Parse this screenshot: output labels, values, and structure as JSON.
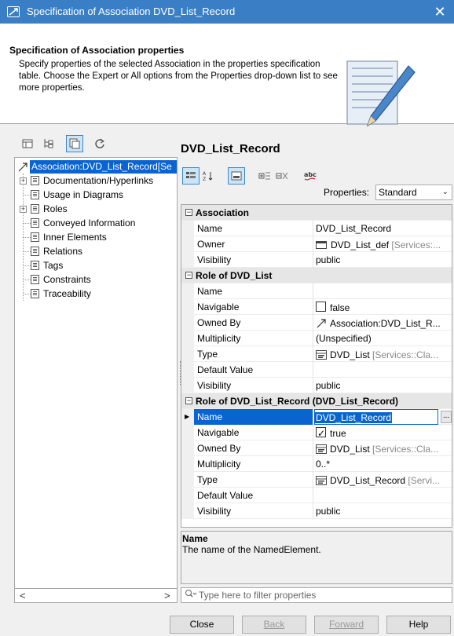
{
  "window": {
    "title": "Specification of Association DVD_List_Record",
    "close_glyph": "✕"
  },
  "header": {
    "title": "Specification of Association properties",
    "description": "Specify properties of the selected Association in the properties specification table. Choose the Expert or All options from the Properties drop-down list to see more properties."
  },
  "left_toolbar": {
    "icons": [
      "class-diagram-icon",
      "tree-icon",
      "copy-icon",
      "refresh-icon"
    ]
  },
  "tree": {
    "root": "Association:DVD_List_Record[Se",
    "items": [
      {
        "label": "Documentation/Hyperlinks",
        "expandable": true
      },
      {
        "label": "Usage in Diagrams",
        "expandable": false
      },
      {
        "label": "Roles",
        "expandable": true
      },
      {
        "label": "Conveyed Information",
        "expandable": false
      },
      {
        "label": "Inner Elements",
        "expandable": false
      },
      {
        "label": "Relations",
        "expandable": false
      },
      {
        "label": "Tags",
        "expandable": false
      },
      {
        "label": "Constraints",
        "expandable": false
      },
      {
        "label": "Traceability",
        "expandable": false
      }
    ]
  },
  "right": {
    "title": "DVD_List_Record",
    "properties_label": "Properties:",
    "properties_value": "Standard"
  },
  "grid": {
    "sections": [
      {
        "title": "Association",
        "rows": [
          {
            "name": "Name",
            "value": "DVD_List_Record"
          },
          {
            "name": "Owner",
            "value": "DVD_List_def",
            "suffix": " [Services:..."
          },
          {
            "name": "Visibility",
            "value": "public"
          }
        ]
      },
      {
        "title": "Role of DVD_List",
        "rows": [
          {
            "name": "Name",
            "value": ""
          },
          {
            "name": "Navigable",
            "value": "false"
          },
          {
            "name": "Owned By",
            "value": "Association:DVD_List_R..."
          },
          {
            "name": "Multiplicity",
            "value": "(Unspecified)"
          },
          {
            "name": "Type",
            "value": "DVD_List",
            "suffix": " [Services::Cla..."
          },
          {
            "name": "Default Value",
            "value": ""
          },
          {
            "name": "Visibility",
            "value": "public"
          }
        ]
      },
      {
        "title": "Role of DVD_List_Record (DVD_List_Record)",
        "rows": [
          {
            "name": "Name",
            "value": "DVD_List_Record",
            "ellipsis": "..."
          },
          {
            "name": "Navigable",
            "value": "true"
          },
          {
            "name": "Owned By",
            "value": "DVD_List",
            "suffix": " [Services::Cla..."
          },
          {
            "name": "Multiplicity",
            "value": "0..*"
          },
          {
            "name": "Type",
            "value": "DVD_List_Record",
            "suffix": " [Servi..."
          },
          {
            "name": "Default Value",
            "value": ""
          },
          {
            "name": "Visibility",
            "value": "public"
          }
        ]
      }
    ]
  },
  "description": {
    "title": "Name",
    "text": "The name of the NamedElement."
  },
  "filter": {
    "placeholder": "Type here to filter properties"
  },
  "buttons": {
    "close": "Close",
    "back": "Back",
    "forward": "Forward",
    "help": "Help"
  },
  "colors": {
    "titlebar": "#3a7fc5",
    "selection": "#0a64d0"
  }
}
